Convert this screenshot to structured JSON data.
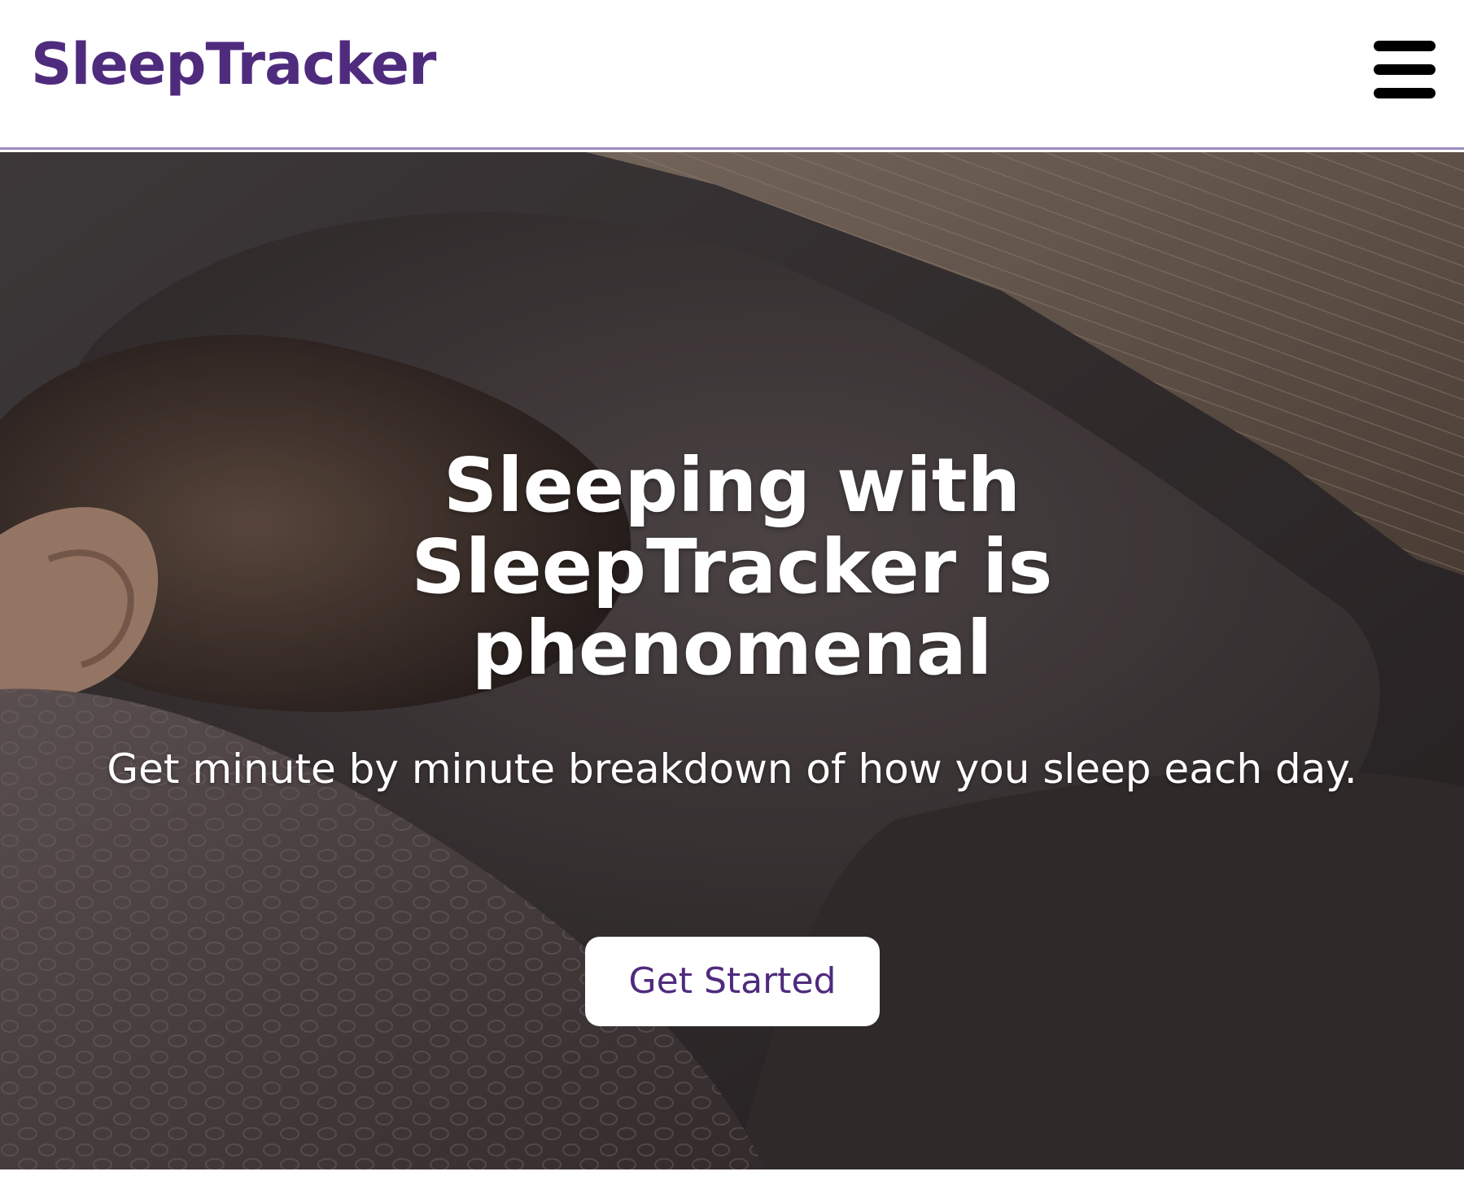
{
  "header": {
    "logo_text": "SleepTracker",
    "menu_icon": "hamburger-menu-icon"
  },
  "hero": {
    "background_image": "person-sleeping-on-pillow-photo",
    "title": "Sleeping with SleepTracker is phenomenal",
    "subtitle": "Get minute by minute breakdown of how you sleep each day.",
    "cta_label": "Get Started"
  },
  "colors": {
    "brand": "#4f2b7e",
    "header_border": "#9a8ac0",
    "button_bg": "#ffffff",
    "hero_overlay": "#3a3233"
  }
}
